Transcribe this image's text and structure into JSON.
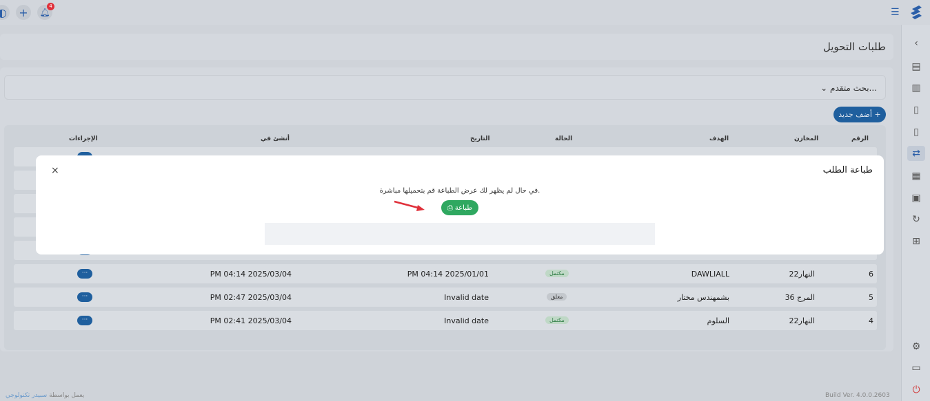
{
  "topbar": {
    "notification_count": "4",
    "icons": [
      "logo-icon",
      "menu-icon",
      "plus-icon",
      "bell-icon"
    ]
  },
  "page": {
    "title": "طلبات التحويل"
  },
  "search": {
    "label": "بحث متقدم..."
  },
  "actions": {
    "add_label": "أضف جديد"
  },
  "table": {
    "headers": {
      "number": "الرقم",
      "store": "المخازن",
      "target": "الهدف",
      "status": "الحالة",
      "date": "التاريخ",
      "created_at": "أنشئ في",
      "actions": "الإجراءات"
    },
    "rows": [
      {
        "number": "6",
        "store": "النهار22",
        "target": "DAWLIALL",
        "status": "مكتمل",
        "date": "PM 04:14 2025/01/01",
        "created_at": "PM 04:14 2025/03/04",
        "action": "···"
      },
      {
        "number": "5",
        "store": "المرج 36",
        "target": "بشمهندس مختار",
        "status": "معلق",
        "date": "Invalid date",
        "created_at": "PM 02:47 2025/03/04",
        "action": "···"
      },
      {
        "number": "4",
        "store": "النهار22",
        "target": "السلوم",
        "status": "مكتمل",
        "date": "Invalid date",
        "created_at": "PM 02:41 2025/03/04",
        "action": "···"
      }
    ]
  },
  "modal": {
    "title": "طباعة الطلب",
    "message": "في حال لم يظهر لك عرض الطباعة قم بتحميلها مباشرة.",
    "print_label": "طباعة",
    "close_glyph": "×"
  },
  "footer": {
    "powered_prefix": "يعمل بواسطة",
    "powered_brand": "سبيدر تكنولوجي",
    "build": "Build Ver. 4.0.0.2603"
  },
  "colors": {
    "primary": "#1f5f9e",
    "success": "#2fa860",
    "danger": "#e0303a"
  }
}
